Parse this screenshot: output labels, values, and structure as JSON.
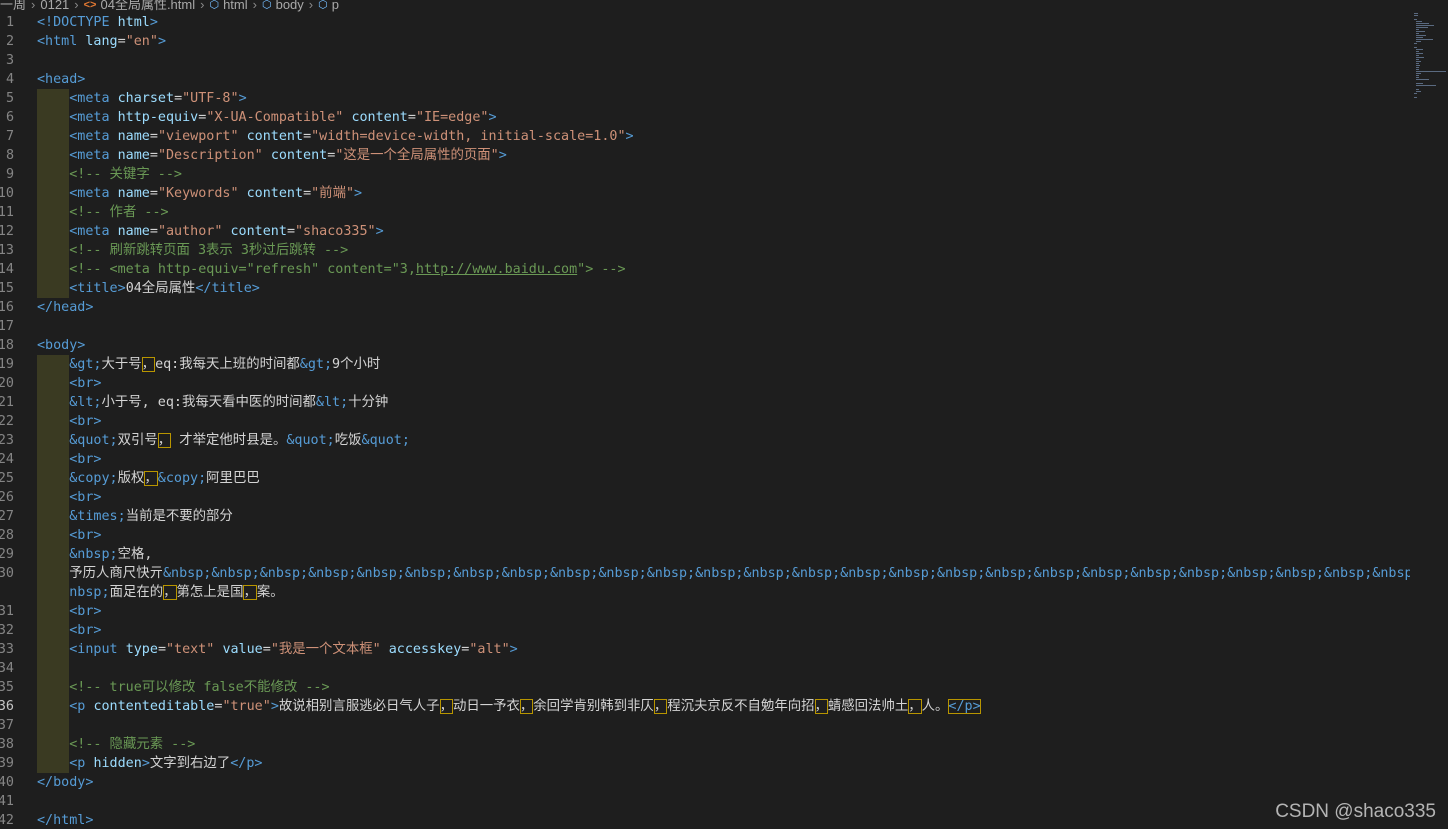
{
  "breadcrumb": {
    "items": [
      "一周",
      "0121",
      "04全局属性.html",
      "html",
      "body",
      "p"
    ]
  },
  "watermark": "CSDN @shaco335",
  "colors": {
    "background": "#1e1e1e",
    "tag": "#569cd6",
    "attribute": "#9cdcfe",
    "string": "#ce9178",
    "comment": "#6a9955",
    "text": "#d4d4d4"
  },
  "editor": {
    "active_line": "36",
    "lines": [
      {
        "num": "1",
        "indent": 0,
        "tokens": [
          [
            "t",
            "<!DOCTYPE "
          ],
          [
            "a",
            "html"
          ],
          [
            "t",
            ">"
          ]
        ]
      },
      {
        "num": "2",
        "indent": 0,
        "tokens": [
          [
            "t",
            "<html "
          ],
          [
            "a",
            "lang"
          ],
          [
            "txt",
            "="
          ],
          [
            "s",
            "\"en\""
          ],
          [
            "t",
            ">"
          ]
        ]
      },
      {
        "num": "3",
        "indent": 0,
        "tokens": []
      },
      {
        "num": "4",
        "indent": 0,
        "tokens": [
          [
            "t",
            "<head>"
          ]
        ]
      },
      {
        "num": "5",
        "indent": 1,
        "tokens": [
          [
            "t",
            "<meta "
          ],
          [
            "a",
            "charset"
          ],
          [
            "txt",
            "="
          ],
          [
            "s",
            "\"UTF-8\""
          ],
          [
            "t",
            ">"
          ]
        ]
      },
      {
        "num": "6",
        "indent": 1,
        "tokens": [
          [
            "t",
            "<meta "
          ],
          [
            "a",
            "http-equiv"
          ],
          [
            "txt",
            "="
          ],
          [
            "s",
            "\"X-UA-Compatible\""
          ],
          [
            "txt",
            " "
          ],
          [
            "a",
            "content"
          ],
          [
            "txt",
            "="
          ],
          [
            "s",
            "\"IE=edge\""
          ],
          [
            "t",
            ">"
          ]
        ]
      },
      {
        "num": "7",
        "indent": 1,
        "tokens": [
          [
            "t",
            "<meta "
          ],
          [
            "a",
            "name"
          ],
          [
            "txt",
            "="
          ],
          [
            "s",
            "\"viewport\""
          ],
          [
            "txt",
            " "
          ],
          [
            "a",
            "content"
          ],
          [
            "txt",
            "="
          ],
          [
            "s",
            "\"width=device-width, initial-scale=1.0\""
          ],
          [
            "t",
            ">"
          ]
        ]
      },
      {
        "num": "8",
        "indent": 1,
        "tokens": [
          [
            "t",
            "<meta "
          ],
          [
            "a",
            "name"
          ],
          [
            "txt",
            "="
          ],
          [
            "s",
            "\"Description\""
          ],
          [
            "txt",
            " "
          ],
          [
            "a",
            "content"
          ],
          [
            "txt",
            "="
          ],
          [
            "s",
            "\"这是一个全局属性的页面\""
          ],
          [
            "t",
            ">"
          ]
        ]
      },
      {
        "num": "9",
        "indent": 1,
        "tokens": [
          [
            "c",
            "<!-- 关键字 -->"
          ]
        ]
      },
      {
        "num": "10",
        "indent": 1,
        "tokens": [
          [
            "t",
            "<meta "
          ],
          [
            "a",
            "name"
          ],
          [
            "txt",
            "="
          ],
          [
            "s",
            "\"Keywords\""
          ],
          [
            "txt",
            " "
          ],
          [
            "a",
            "content"
          ],
          [
            "txt",
            "="
          ],
          [
            "s",
            "\"前端\""
          ],
          [
            "t",
            ">"
          ]
        ]
      },
      {
        "num": "11",
        "indent": 1,
        "tokens": [
          [
            "c",
            "<!-- 作者 -->"
          ]
        ]
      },
      {
        "num": "12",
        "indent": 1,
        "tokens": [
          [
            "t",
            "<meta "
          ],
          [
            "a",
            "name"
          ],
          [
            "txt",
            "="
          ],
          [
            "s",
            "\"author\""
          ],
          [
            "txt",
            " "
          ],
          [
            "a",
            "content"
          ],
          [
            "txt",
            "="
          ],
          [
            "s",
            "\"shaco335\""
          ],
          [
            "t",
            ">"
          ]
        ]
      },
      {
        "num": "13",
        "indent": 1,
        "tokens": [
          [
            "c",
            "<!-- 刷新跳转页面 3表示 3秒过后跳转 -->"
          ]
        ]
      },
      {
        "num": "14",
        "indent": 1,
        "tokens": [
          [
            "c",
            "<!-- <meta http-equiv=\"refresh\" content=\"3,"
          ],
          [
            "cu",
            "http://www.baidu.com"
          ],
          [
            "c",
            "\"> -->"
          ]
        ]
      },
      {
        "num": "15",
        "indent": 1,
        "tokens": [
          [
            "t",
            "<title>"
          ],
          [
            "txt",
            "04全局属性"
          ],
          [
            "t",
            "</title>"
          ]
        ]
      },
      {
        "num": "16",
        "indent": 0,
        "tokens": [
          [
            "t",
            "</head>"
          ]
        ]
      },
      {
        "num": "17",
        "indent": 0,
        "tokens": []
      },
      {
        "num": "18",
        "indent": 0,
        "tokens": [
          [
            "t",
            "<body>"
          ]
        ]
      },
      {
        "num": "19",
        "indent": 1,
        "tokens": [
          [
            "e",
            "&gt;"
          ],
          [
            "txt",
            "大于号"
          ],
          [
            "hl",
            "，"
          ],
          [
            "txt",
            "eq:我每天上班的时间都"
          ],
          [
            "e",
            "&gt;"
          ],
          [
            "txt",
            "9个小时"
          ]
        ]
      },
      {
        "num": "20",
        "indent": 1,
        "tokens": [
          [
            "t",
            "<br>"
          ]
        ]
      },
      {
        "num": "21",
        "indent": 1,
        "tokens": [
          [
            "e",
            "&lt;"
          ],
          [
            "txt",
            "小于号, eq:我每天看中医的时间都"
          ],
          [
            "e",
            "&lt;"
          ],
          [
            "txt",
            "十分钟"
          ]
        ]
      },
      {
        "num": "22",
        "indent": 1,
        "tokens": [
          [
            "t",
            "<br>"
          ]
        ]
      },
      {
        "num": "23",
        "indent": 1,
        "tokens": [
          [
            "e",
            "&quot;"
          ],
          [
            "txt",
            "双引号"
          ],
          [
            "hl",
            "，"
          ],
          [
            "txt",
            " 才举定他时县是。"
          ],
          [
            "e",
            "&quot;"
          ],
          [
            "txt",
            "吃饭"
          ],
          [
            "e",
            "&quot;"
          ]
        ]
      },
      {
        "num": "24",
        "indent": 1,
        "tokens": [
          [
            "t",
            "<br>"
          ]
        ]
      },
      {
        "num": "25",
        "indent": 1,
        "tokens": [
          [
            "e",
            "&copy;"
          ],
          [
            "txt",
            "版权"
          ],
          [
            "hl",
            "，"
          ],
          [
            "e",
            "&copy;"
          ],
          [
            "txt",
            "阿里巴巴"
          ]
        ]
      },
      {
        "num": "26",
        "indent": 1,
        "tokens": [
          [
            "t",
            "<br>"
          ]
        ]
      },
      {
        "num": "27",
        "indent": 1,
        "tokens": [
          [
            "e",
            "&times;"
          ],
          [
            "txt",
            "当前是不要的部分"
          ]
        ]
      },
      {
        "num": "28",
        "indent": 1,
        "tokens": [
          [
            "t",
            "<br>"
          ]
        ]
      },
      {
        "num": "29",
        "indent": 1,
        "tokens": [
          [
            "e",
            "&nbsp;"
          ],
          [
            "txt",
            "空格,"
          ]
        ]
      },
      {
        "num": "30",
        "indent": 1,
        "tokens": [
          [
            "txt",
            "予历人商尺快亓"
          ],
          [
            "e",
            "&nbsp;&nbsp;&nbsp;&nbsp;&nbsp;&nbsp;&nbsp;&nbsp;&nbsp;&nbsp;&nbsp;&nbsp;&nbsp;&nbsp;&nbsp;&nbsp;&nbsp;&nbsp;&nbsp;&nbsp;&nbsp;&nbsp;&nbsp;&nbsp;&nbsp;&nbsp;&"
          ]
        ]
      },
      {
        "num": "",
        "indent": 1,
        "tokens": [
          [
            "e",
            "nbsp;"
          ],
          [
            "txt",
            "面足在的"
          ],
          [
            "hl",
            "，"
          ],
          [
            "txt",
            "第怎上是国"
          ],
          [
            "hl",
            "，"
          ],
          [
            "txt",
            "案。"
          ]
        ]
      },
      {
        "num": "31",
        "indent": 1,
        "tokens": [
          [
            "t",
            "<br>"
          ]
        ]
      },
      {
        "num": "32",
        "indent": 1,
        "tokens": [
          [
            "t",
            "<br>"
          ]
        ]
      },
      {
        "num": "33",
        "indent": 1,
        "tokens": [
          [
            "t",
            "<input "
          ],
          [
            "a",
            "type"
          ],
          [
            "txt",
            "="
          ],
          [
            "s",
            "\"text\""
          ],
          [
            "txt",
            " "
          ],
          [
            "a",
            "value"
          ],
          [
            "txt",
            "="
          ],
          [
            "s",
            "\"我是一个文本框\""
          ],
          [
            "txt",
            " "
          ],
          [
            "a",
            "accesskey"
          ],
          [
            "txt",
            "="
          ],
          [
            "s",
            "\"alt\""
          ],
          [
            "t",
            ">"
          ]
        ]
      },
      {
        "num": "34",
        "indent": 1,
        "tokens": []
      },
      {
        "num": "35",
        "indent": 1,
        "tokens": [
          [
            "c",
            "<!-- true可以修改 false不能修改 -->"
          ]
        ]
      },
      {
        "num": "36",
        "indent": 1,
        "tokens": [
          [
            "t",
            "<p "
          ],
          [
            "a",
            "contenteditable"
          ],
          [
            "txt",
            "="
          ],
          [
            "s",
            "\"true\""
          ],
          [
            "t",
            ">"
          ],
          [
            "txt",
            "故说相别言服逃必日气人子"
          ],
          [
            "hl",
            "，"
          ],
          [
            "txt",
            "动日一予衣"
          ],
          [
            "hl",
            "，"
          ],
          [
            "txt",
            "余回学肯别韩到非仄"
          ],
          [
            "hl",
            "，"
          ],
          [
            "txt",
            "程沉夫京反不自勉年向招"
          ],
          [
            "hl",
            "，"
          ],
          [
            "txt",
            "蜻感回法帅土"
          ],
          [
            "hl",
            "，"
          ],
          [
            "txt",
            "人。"
          ],
          [
            "th",
            "</p>"
          ]
        ]
      },
      {
        "num": "37",
        "indent": 1,
        "tokens": []
      },
      {
        "num": "38",
        "indent": 1,
        "tokens": [
          [
            "c",
            "<!-- 隐藏元素 -->"
          ]
        ]
      },
      {
        "num": "39",
        "indent": 1,
        "tokens": [
          [
            "t",
            "<p "
          ],
          [
            "a",
            "hidden"
          ],
          [
            "t",
            ">"
          ],
          [
            "txt",
            "文字到右边了"
          ],
          [
            "t",
            "</p>"
          ]
        ]
      },
      {
        "num": "40",
        "indent": 0,
        "tokens": [
          [
            "t",
            "</body>"
          ]
        ]
      },
      {
        "num": "41",
        "indent": 0,
        "tokens": []
      },
      {
        "num": "42",
        "indent": 0,
        "tokens": [
          [
            "t",
            "</html>"
          ]
        ]
      }
    ]
  }
}
